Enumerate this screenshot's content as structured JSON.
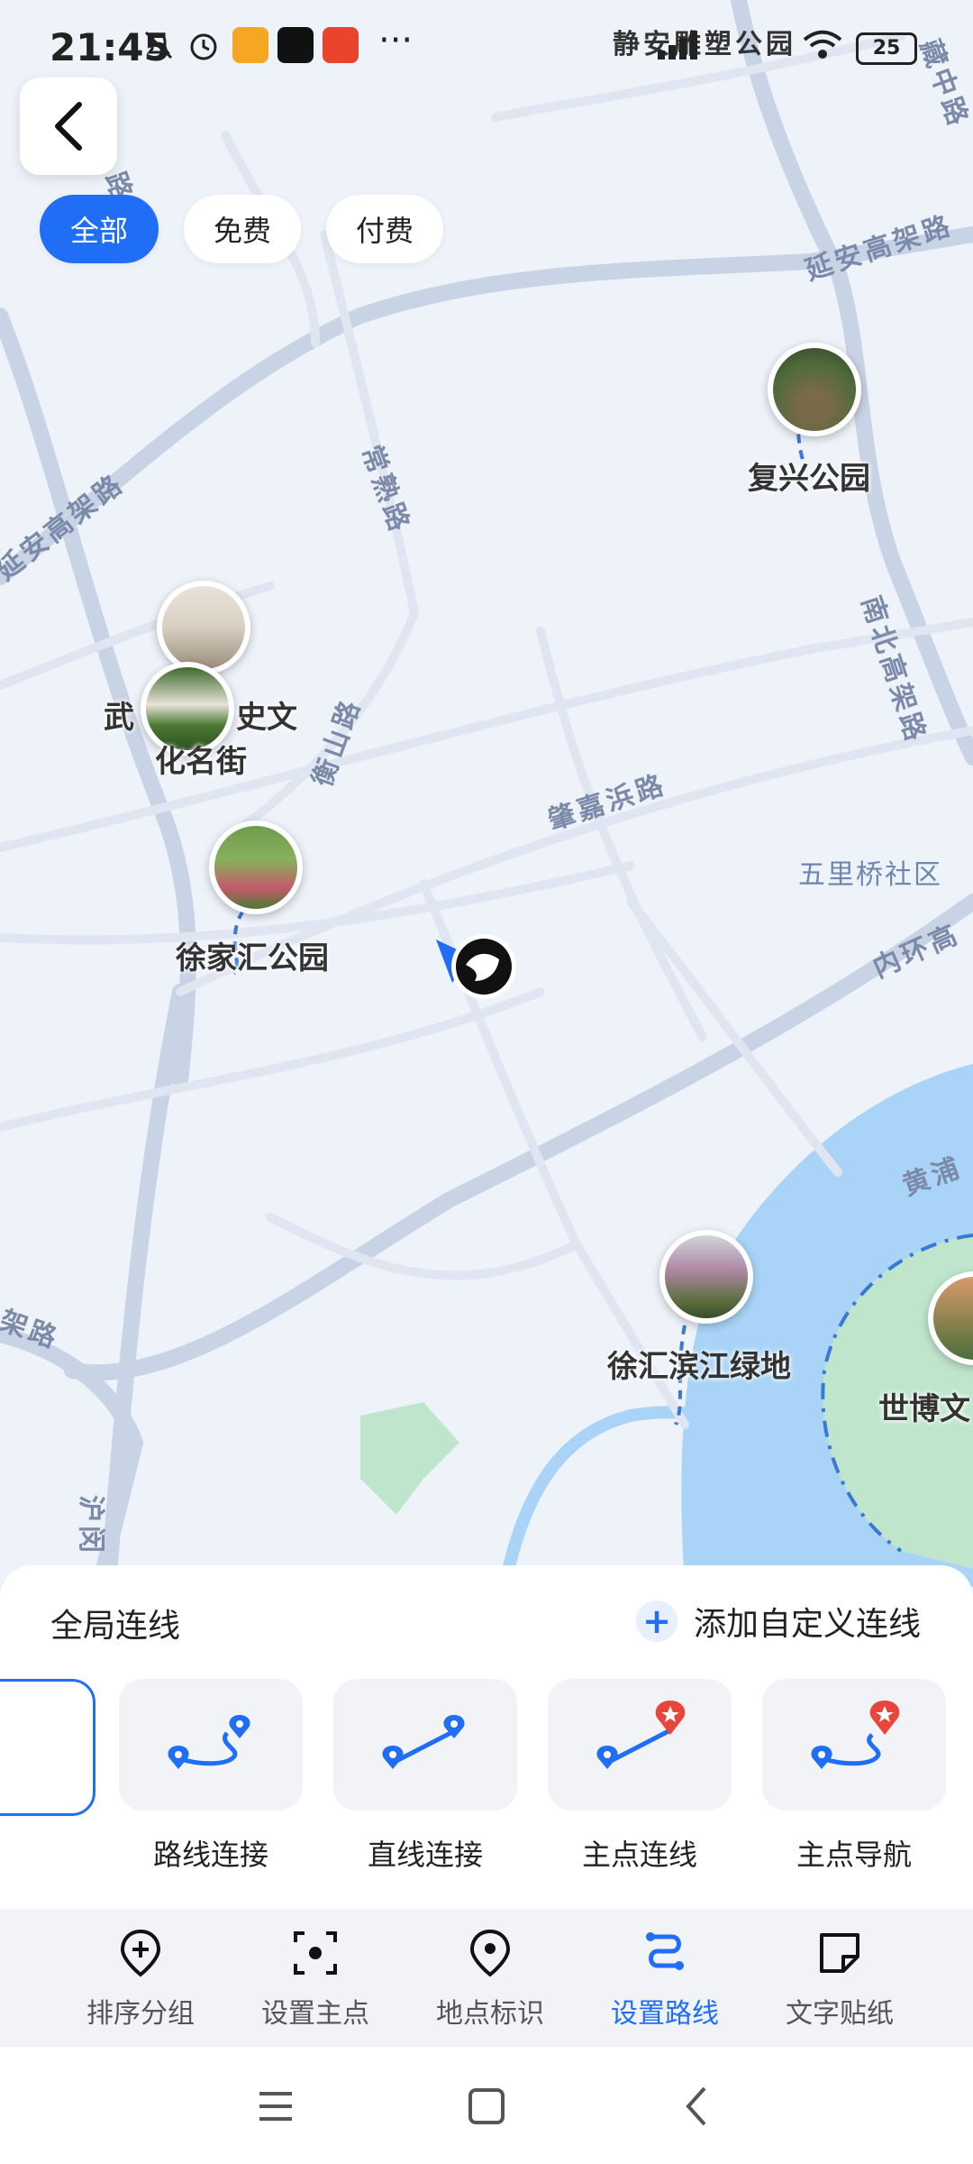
{
  "status_bar": {
    "time": "21:45",
    "battery": "25",
    "more": "···"
  },
  "filters": [
    {
      "label": "全部",
      "active": true
    },
    {
      "label": "免费",
      "active": false
    },
    {
      "label": "付费",
      "active": false
    }
  ],
  "map": {
    "top_label": "静安雕塑公园",
    "road_labels": {
      "yanan_east": "延安高架路",
      "yanan_west": "延安高架路",
      "changshu": "常熟路",
      "hengshan": "衡山路",
      "zhaojiabang": "肇嘉浜路",
      "nanbei": "南北高架路",
      "neihuan": "内环高",
      "huangpu": "黄浦",
      "hudong": "沪闵",
      "jialu": "架路",
      "zang": "藏中路",
      "lu_left": "路"
    },
    "district": "五里桥社区",
    "pois": [
      {
        "name": "复兴公园"
      },
      {
        "name": "武康路历史文化名街"
      },
      {
        "name": "徐家汇公园"
      },
      {
        "name": "徐汇滨江绿地"
      },
      {
        "name": "世博文化公园"
      }
    ],
    "poi_labels": {
      "fuxing": "复兴公园",
      "wukang_line1": "武",
      "wukang_line1b": "史文",
      "wukang_line2": "化名街",
      "xujiahui": "徐家汇公园",
      "binjiang": "徐汇滨江绿地",
      "shibo": "世博文"
    }
  },
  "sheet": {
    "title": "全局连线",
    "add_custom": "添加自定义连线",
    "add_icon": "+",
    "options": [
      {
        "label": "路线连接",
        "icon": "route-curve-icon"
      },
      {
        "label": "直线连接",
        "icon": "straight-line-icon"
      },
      {
        "label": "主点连线",
        "icon": "main-point-line-icon"
      },
      {
        "label": "主点导航",
        "icon": "main-point-nav-icon"
      }
    ]
  },
  "tabs": [
    {
      "label": "排序分组",
      "icon": "plus-pin-icon",
      "active": false
    },
    {
      "label": "设置主点",
      "icon": "focus-point-icon",
      "active": false
    },
    {
      "label": "地点标识",
      "icon": "location-pin-icon",
      "active": false
    },
    {
      "label": "设置路线",
      "icon": "route-icon",
      "active": true
    },
    {
      "label": "文字贴纸",
      "icon": "sticker-icon",
      "active": false
    }
  ],
  "colors": {
    "accent": "#1f6ef5",
    "water": "#a9d4f7",
    "park": "#bfe6cc",
    "road": "#c9d3e6"
  }
}
